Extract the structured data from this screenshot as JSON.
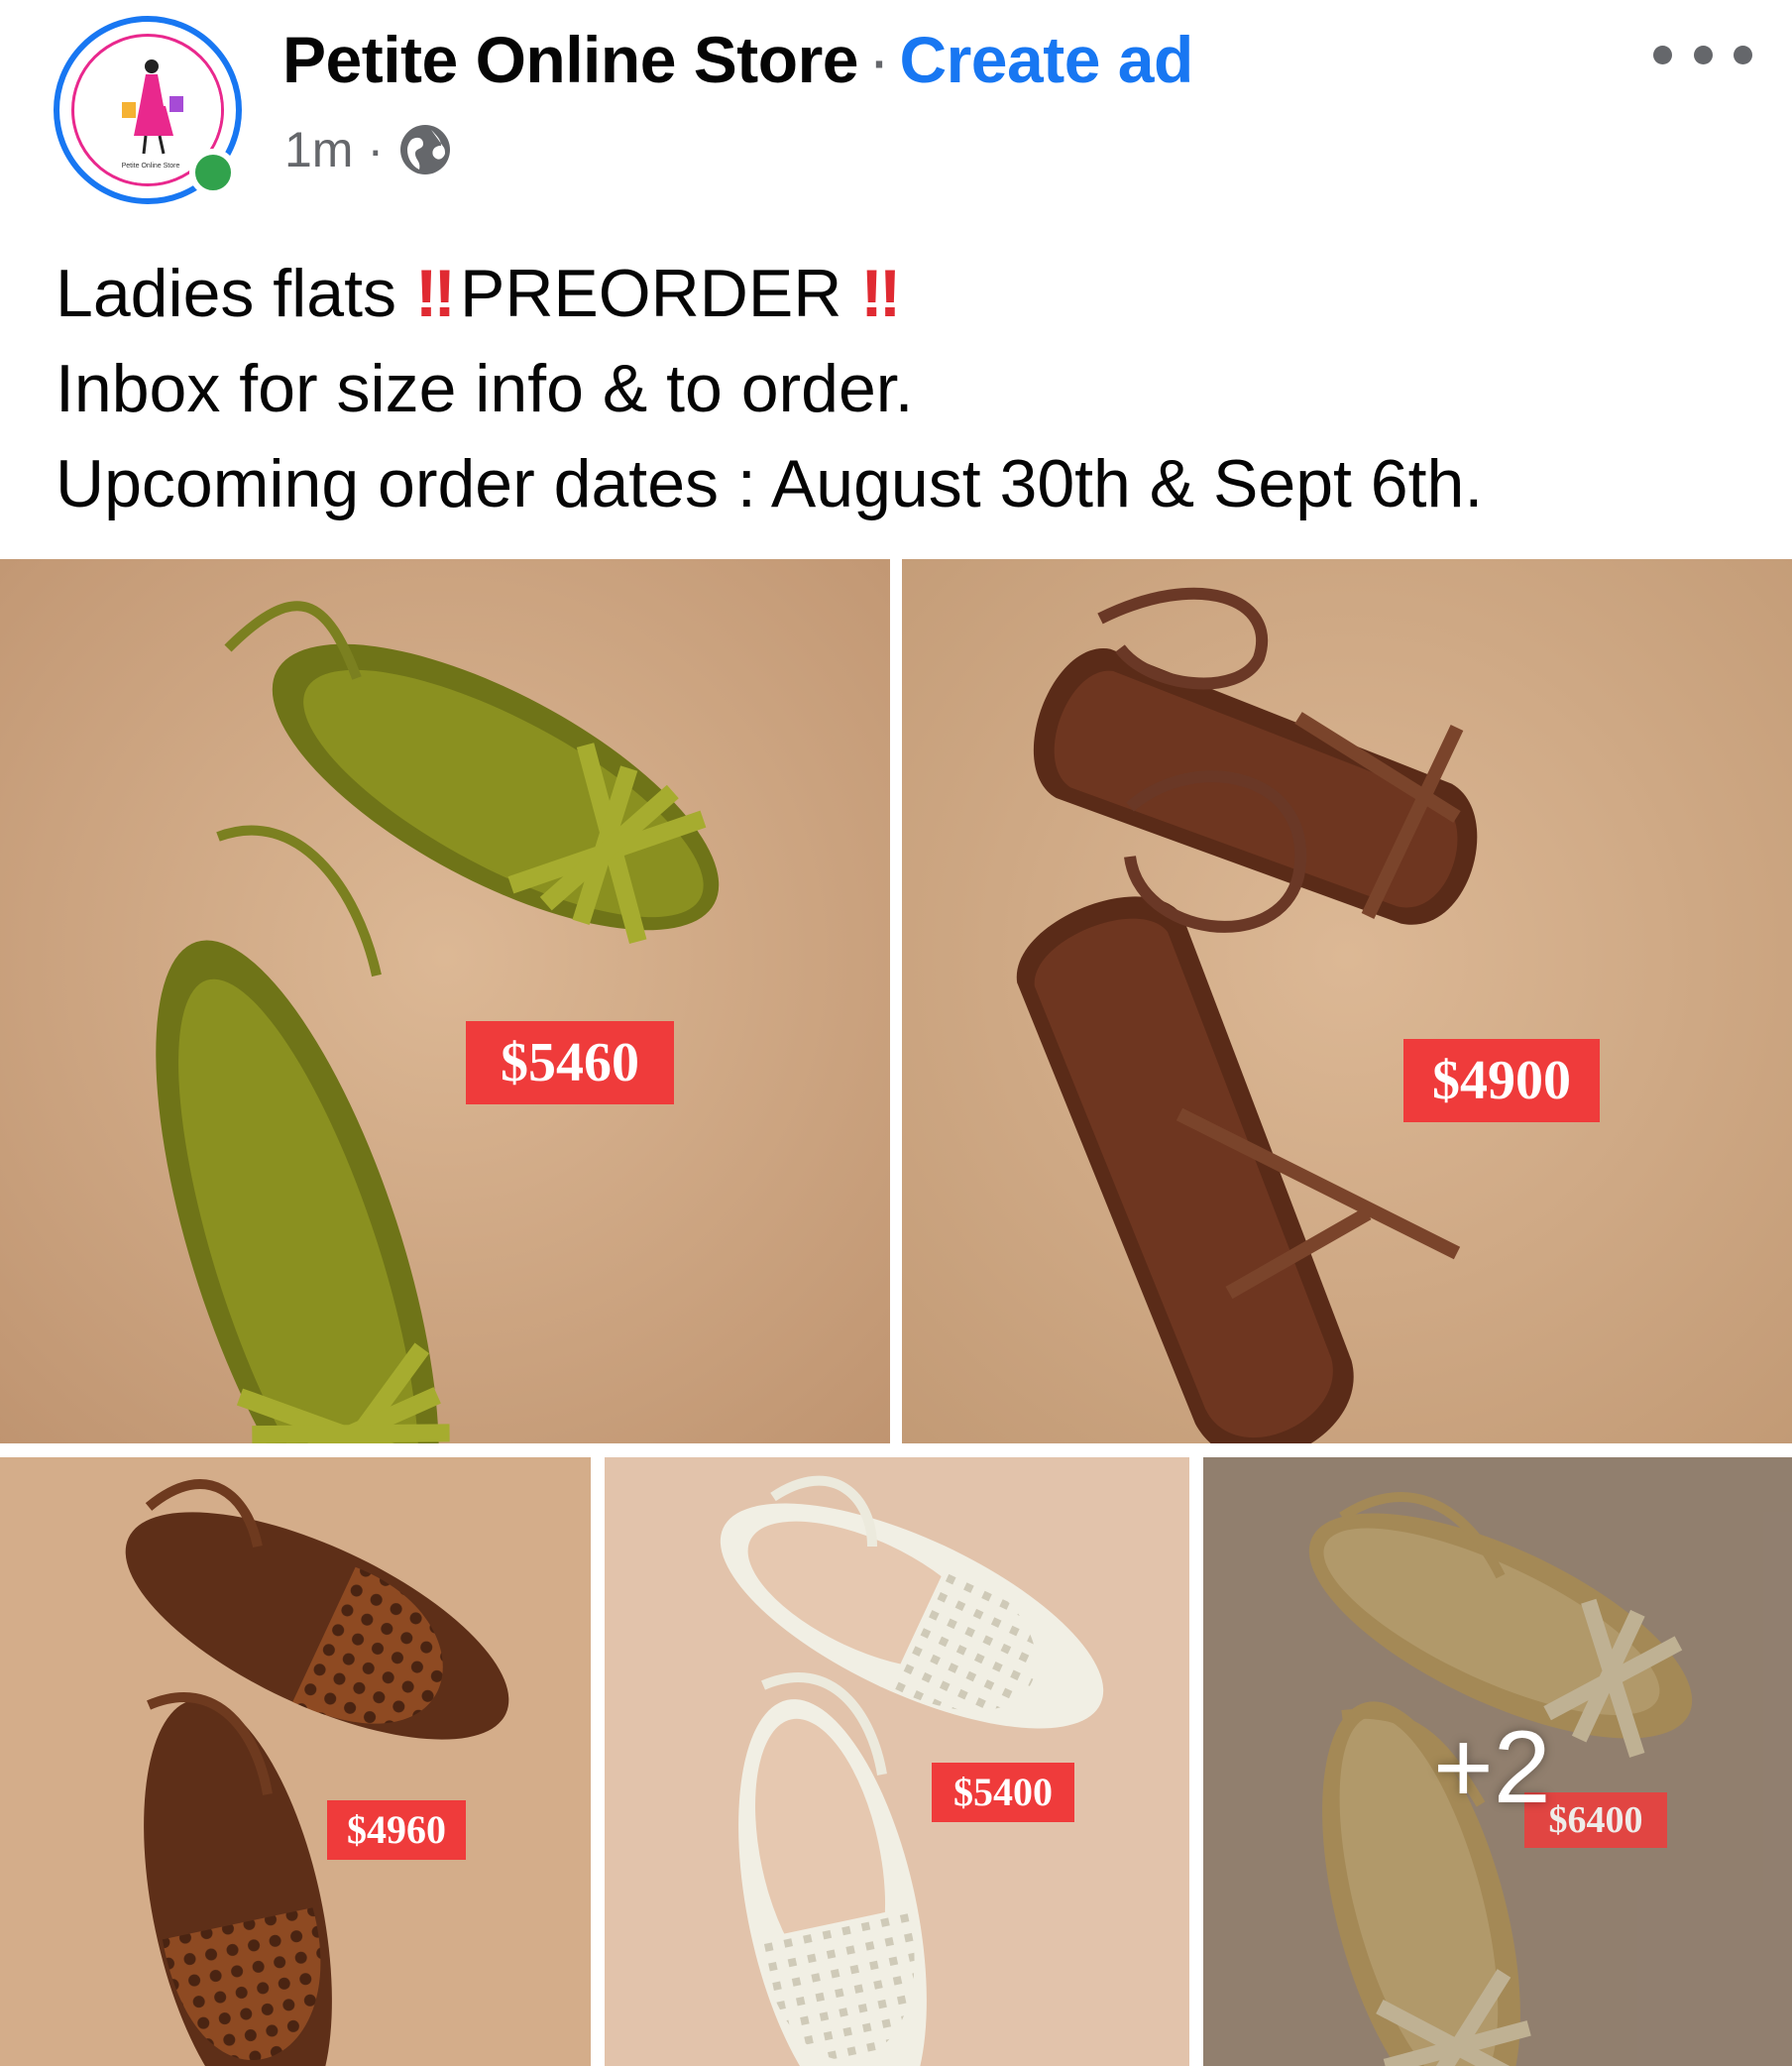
{
  "post": {
    "author": "Petite Online Store",
    "separator": "·",
    "create_ad": "Create ad",
    "time": "1m",
    "meta_separator": "·",
    "audience_icon": "globe-icon",
    "more_icon": "more-options-icon",
    "avatar_logo_text": "Petite Online Store",
    "caption": {
      "line1_a": "Ladies flats",
      "line1_b": "PREORDER",
      "emoji": "‼",
      "line2": "Inbox for size info & to order.",
      "line3": "Upcoming order dates : August 30th & Sept 6th."
    }
  },
  "photos": [
    {
      "price": "$5460",
      "description": "olive green strappy slingback flats"
    },
    {
      "price": "$4900",
      "description": "brown toe-loop ankle strap flats"
    },
    {
      "price": "$4960",
      "description": "tan woven slingback flats"
    },
    {
      "price": "$5400",
      "description": "white woven slingback flats"
    },
    {
      "price": "$6400",
      "description": "gold metallic woven sandals",
      "more_count": "+2"
    }
  ],
  "colors": {
    "accent": "#1877f2",
    "online": "#31a24c",
    "price_tag": "#ef3b3b",
    "emoji_red": "#e02a32",
    "secondary_text": "#65676b"
  }
}
